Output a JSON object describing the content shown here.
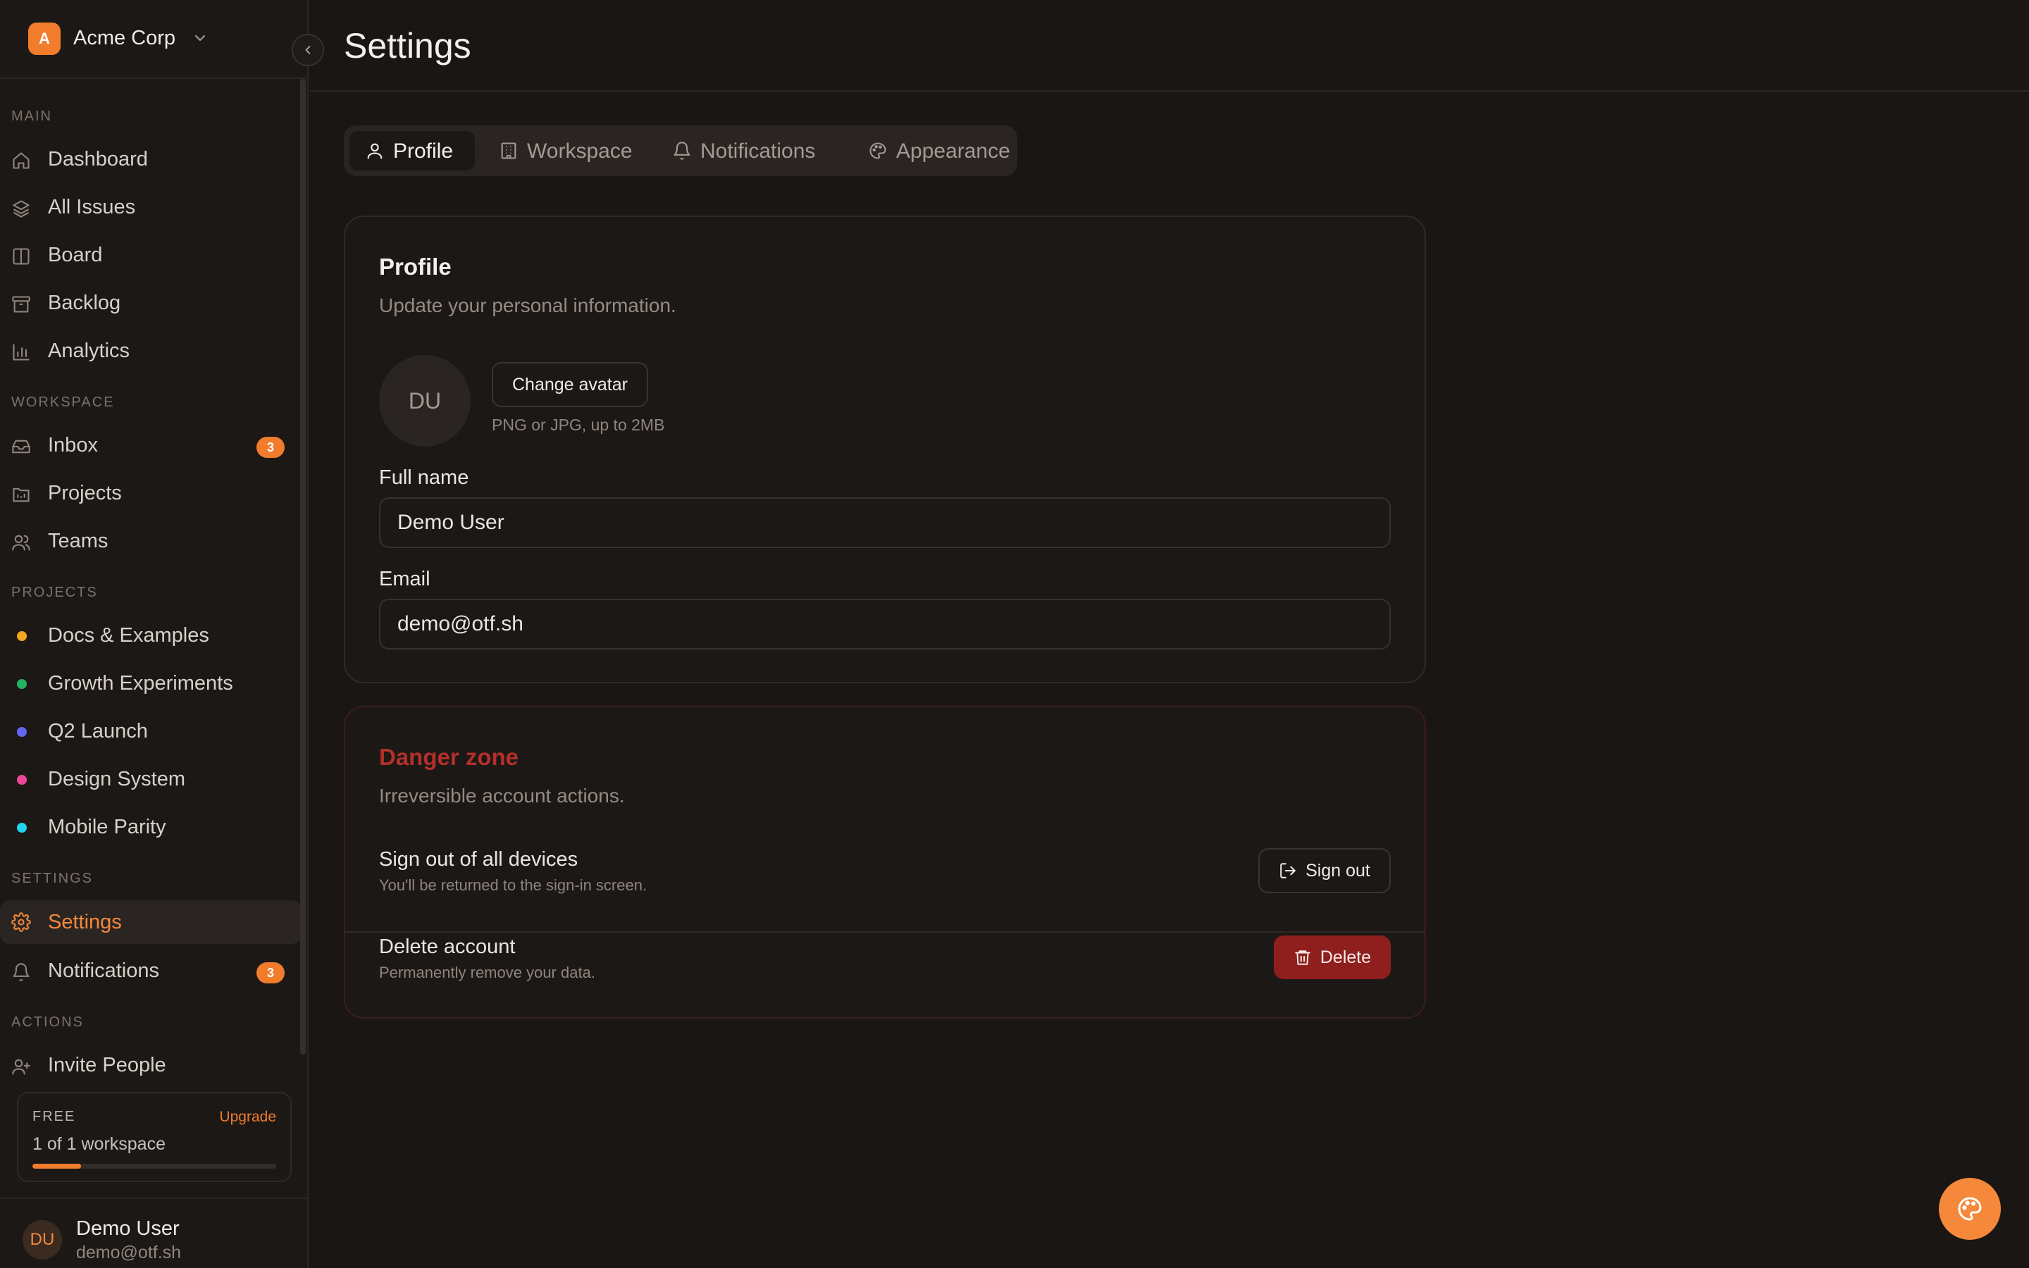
{
  "org": {
    "initial": "A",
    "name": "Acme Corp"
  },
  "sidebar": {
    "sections": {
      "main": "MAIN",
      "workspace": "WORKSPACE",
      "projects": "PROJECTS",
      "settings": "SETTINGS",
      "actions": "ACTIONS"
    },
    "main_items": [
      {
        "label": "Dashboard",
        "icon": "home-icon"
      },
      {
        "label": "All Issues",
        "icon": "layers-icon"
      },
      {
        "label": "Board",
        "icon": "columns-icon"
      },
      {
        "label": "Backlog",
        "icon": "archive-icon"
      },
      {
        "label": "Analytics",
        "icon": "bar-chart-icon"
      }
    ],
    "workspace_items": [
      {
        "label": "Inbox",
        "icon": "inbox-icon",
        "badge": "3"
      },
      {
        "label": "Projects",
        "icon": "folder-icon"
      },
      {
        "label": "Teams",
        "icon": "users-icon"
      }
    ],
    "projects": [
      {
        "label": "Docs & Examples",
        "color": "#f5a524"
      },
      {
        "label": "Growth Experiments",
        "color": "#22b35e"
      },
      {
        "label": "Q2 Launch",
        "color": "#6366f1"
      },
      {
        "label": "Design System",
        "color": "#ec4899"
      },
      {
        "label": "Mobile Parity",
        "color": "#22d3ee"
      }
    ],
    "settings_items": [
      {
        "label": "Settings",
        "icon": "gear-icon",
        "active": true
      },
      {
        "label": "Notifications",
        "icon": "bell-icon",
        "badge": "3"
      }
    ],
    "action_items": [
      {
        "label": "Invite People",
        "icon": "user-plus-icon"
      }
    ],
    "plan": {
      "tier": "FREE",
      "upgrade": "Upgrade",
      "usage": "1 of 1 workspace",
      "progress": 0.2
    },
    "user": {
      "initials": "DU",
      "name": "Demo User",
      "email": "demo@otf.sh"
    }
  },
  "page": {
    "title": "Settings"
  },
  "tabs": [
    {
      "label": "Profile",
      "icon": "user-icon",
      "active": true
    },
    {
      "label": "Workspace",
      "icon": "building-icon"
    },
    {
      "label": "Notifications",
      "icon": "bell-icon"
    },
    {
      "label": "Appearance",
      "icon": "palette-icon"
    }
  ],
  "profile": {
    "title": "Profile",
    "description": "Update your personal information.",
    "avatar_initials": "DU",
    "change_avatar": "Change avatar",
    "avatar_hint": "PNG or JPG, up to 2MB",
    "full_name_label": "Full name",
    "full_name_value": "Demo User",
    "email_label": "Email",
    "email_value": "demo@otf.sh"
  },
  "danger": {
    "title": "Danger zone",
    "description": "Irreversible account actions.",
    "signout_title": "Sign out of all devices",
    "signout_sub": "You'll be returned to the sign-in screen.",
    "signout_button": "Sign out",
    "delete_title": "Delete account",
    "delete_sub": "Permanently remove your data.",
    "delete_button": "Delete"
  },
  "colors": {
    "accent": "#f07c2c",
    "danger": "#8e1f1d",
    "background": "#1a1614"
  }
}
